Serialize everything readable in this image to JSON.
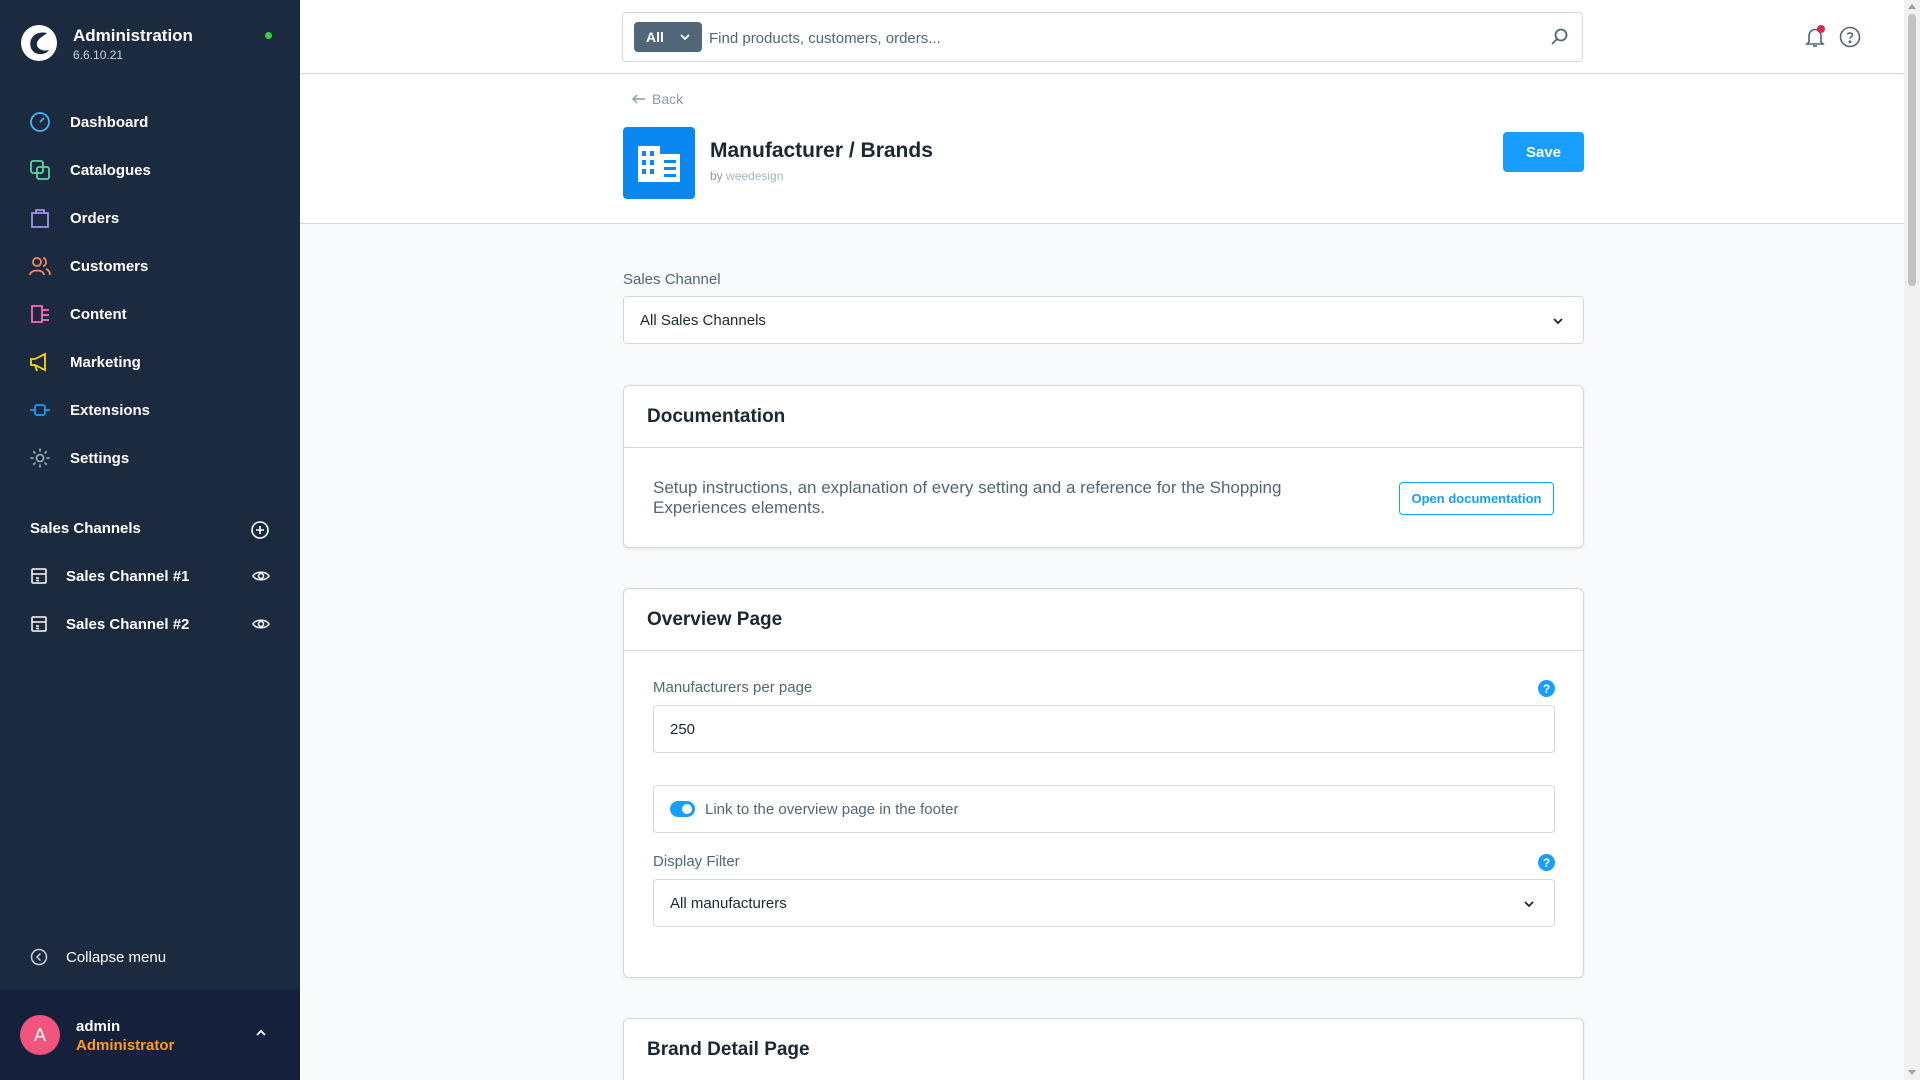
{
  "brand": {
    "title": "Administration",
    "version": "6.6.10.21"
  },
  "nav": [
    {
      "label": "Dashboard",
      "icon": "dashboard-icon",
      "color": "#42b9f4"
    },
    {
      "label": "Catalogues",
      "icon": "catalogues-icon",
      "color": "#57d9a3"
    },
    {
      "label": "Orders",
      "icon": "orders-icon",
      "color": "#a092f0"
    },
    {
      "label": "Customers",
      "icon": "customers-icon",
      "color": "#f88962"
    },
    {
      "label": "Content",
      "icon": "content-icon",
      "color": "#ff68b4"
    },
    {
      "label": "Marketing",
      "icon": "marketing-icon",
      "color": "#ffd700"
    },
    {
      "label": "Extensions",
      "icon": "extensions-icon",
      "color": "#189eff"
    },
    {
      "label": "Settings",
      "icon": "settings-icon",
      "color": "#9aa8b5"
    }
  ],
  "sales_channels": {
    "heading": "Sales Channels",
    "items": [
      {
        "label": "Sales Channel #1"
      },
      {
        "label": "Sales Channel #2"
      }
    ]
  },
  "collapse_label": "Collapse menu",
  "user": {
    "initial": "A",
    "name": "admin",
    "role": "Administrator"
  },
  "search": {
    "type": "All",
    "placeholder": "Find products, customers, orders..."
  },
  "header": {
    "back_label": "Back",
    "title": "Manufacturer / Brands",
    "by_prefix": "by",
    "vendor": "weedesign",
    "save_label": "Save"
  },
  "sales_channel_field": {
    "label": "Sales Channel",
    "value": "All Sales Channels"
  },
  "documentation": {
    "title": "Documentation",
    "text": "Setup instructions, an explanation of every setting and a reference for the Shopping Experiences elements.",
    "button": "Open documentation"
  },
  "overview": {
    "title": "Overview Page",
    "per_page_label": "Manufacturers per page",
    "per_page_value": "250",
    "footer_link_label": "Link to the overview page in the footer",
    "footer_link_enabled": true,
    "display_filter_label": "Display Filter",
    "display_filter_value": "All manufacturers"
  },
  "brand_detail": {
    "title": "Brand Detail Page"
  },
  "colors": {
    "accent": "#189eff",
    "sidebar": "#1c2a40",
    "avatar": "#f1557f",
    "role": "#ff9c1a"
  }
}
